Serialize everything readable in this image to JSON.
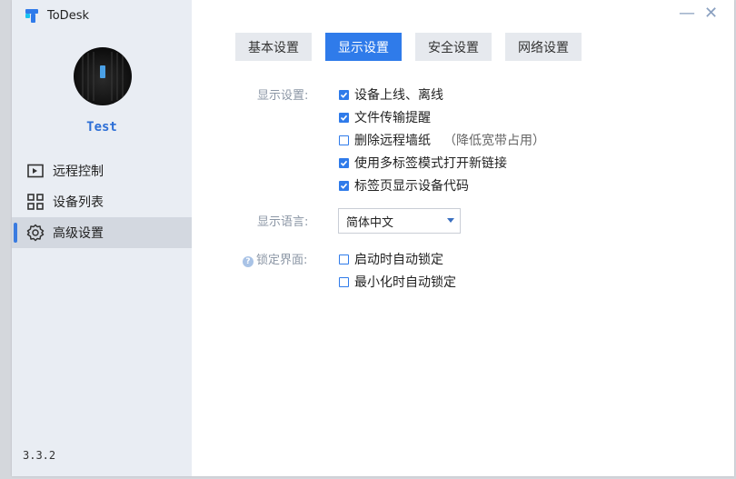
{
  "app": {
    "name": "ToDesk",
    "version": "3.3.2"
  },
  "user": {
    "name": "Test"
  },
  "window_controls": {
    "minimize": "—",
    "close": "✕"
  },
  "sidebar": {
    "items": [
      {
        "label": "远程控制",
        "icon": "remote-control-icon"
      },
      {
        "label": "设备列表",
        "icon": "device-grid-icon"
      },
      {
        "label": "高级设置",
        "icon": "gear-icon",
        "active": true
      }
    ]
  },
  "tabs": [
    {
      "label": "基本设置"
    },
    {
      "label": "显示设置",
      "active": true
    },
    {
      "label": "安全设置"
    },
    {
      "label": "网络设置"
    }
  ],
  "display": {
    "label": "显示设置:",
    "options": [
      {
        "label": "设备上线、离线",
        "checked": true
      },
      {
        "label": "文件传输提醒",
        "checked": true
      },
      {
        "label": "删除远程墙纸",
        "note": "（降低宽带占用）",
        "checked": false
      },
      {
        "label": "使用多标签模式打开新链接",
        "checked": true
      },
      {
        "label": "标签页显示设备代码",
        "checked": true
      }
    ]
  },
  "language": {
    "label": "显示语言:",
    "selected": "简体中文"
  },
  "lock": {
    "label": "锁定界面:",
    "options": [
      {
        "label": "启动时自动锁定",
        "checked": false
      },
      {
        "label": "最小化时自动锁定",
        "checked": false
      }
    ]
  },
  "colors": {
    "accent": "#2f7bea",
    "sidebar_bg": "#e9edf3",
    "label_gray": "#8b96a5"
  }
}
